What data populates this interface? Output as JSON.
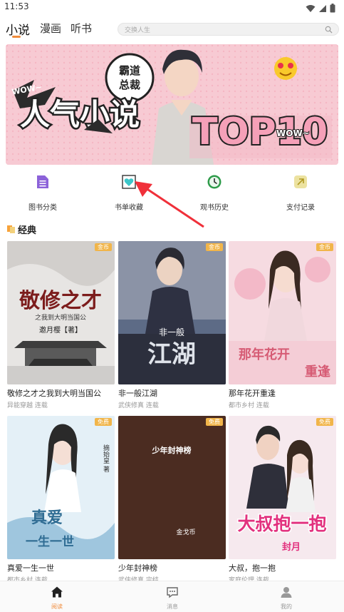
{
  "status_bar": {
    "time": "11:53"
  },
  "top_nav": {
    "tabs": [
      {
        "label": "小说",
        "active": true
      },
      {
        "label": "漫画",
        "active": false
      },
      {
        "label": "听书",
        "active": false
      }
    ],
    "search_placeholder": "交换人生"
  },
  "banner": {
    "badge_line1": "霸道",
    "badge_line2": "总裁",
    "headline": "人气小说",
    "top_text": "TOP10",
    "wow_left": "WOW~",
    "wow_right": "WOW~"
  },
  "quick_menu": [
    {
      "label": "图书分类",
      "icon": "book-category-icon",
      "color": "#8c62d9"
    },
    {
      "label": "书单收藏",
      "icon": "favorites-heart-icon",
      "color": "#3cc6c9"
    },
    {
      "label": "观书历史",
      "icon": "clock-history-icon",
      "color": "#2e9b4a"
    },
    {
      "label": "支付记录",
      "icon": "payment-record-icon",
      "color": "#d8c64a"
    }
  ],
  "section": {
    "title": "经典"
  },
  "books": [
    {
      "title": "敬修之才之我到大明当国公",
      "meta": "异能穿越 连载",
      "badge": "金币",
      "cover_text": "敬修之才",
      "cover_sub": "之我到大明当国公",
      "author": "邀月樱【著】"
    },
    {
      "title": "非一般江湖",
      "meta": "武侠修真 连载",
      "badge": "金币",
      "cover_text": "江湖",
      "cover_sub": "非一般"
    },
    {
      "title": "那年花开重逢",
      "meta": "都市乡村 连载",
      "badge": "金币",
      "cover_text": "那年花开",
      "cover_sub": "重逢"
    },
    {
      "title": "真爱一生一世",
      "meta": "都市乡村 连载",
      "badge": "免费",
      "cover_text": "真爱",
      "cover_sub": "一生一世",
      "author": "摘始皇 著"
    },
    {
      "title": "少年封神榜",
      "meta": "武侠修真 完结",
      "badge": "免费",
      "cover_text": "少年封神榜",
      "author": "金戈币"
    },
    {
      "title": "大叔，抱一抱",
      "meta": "家庭伦理 连载",
      "badge": "免费",
      "cover_text": "大叔抱一抱",
      "cover_sub": "封月"
    }
  ],
  "bottom_nav": [
    {
      "label": "阅读",
      "icon": "home-icon",
      "active": true
    },
    {
      "label": "消息",
      "icon": "message-icon",
      "active": false
    },
    {
      "label": "我的",
      "icon": "profile-icon",
      "active": false
    }
  ],
  "colors": {
    "accent": "#f08c3c",
    "badge": "#f1b54a",
    "annotation_arrow": "#f0303a"
  }
}
